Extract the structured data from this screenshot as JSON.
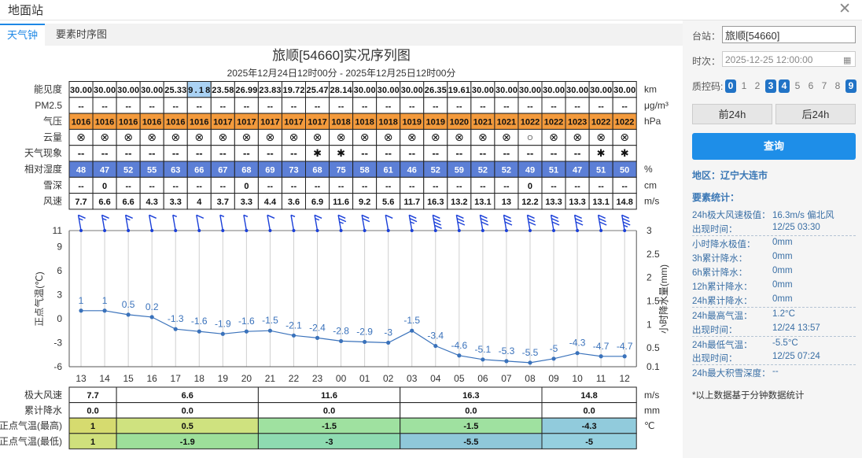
{
  "window": {
    "title": "地面站"
  },
  "tabs": [
    {
      "label": "天气钟"
    },
    {
      "label": "要素时序图"
    }
  ],
  "chart_data": {
    "type": "line",
    "title": "旅顺[54660]实况序列图",
    "subtitle": "2025年12月24日12时00分 - 2025年12月25日12时00分",
    "hours": [
      "13",
      "14",
      "15",
      "16",
      "17",
      "18",
      "19",
      "20",
      "21",
      "22",
      "23",
      "00",
      "01",
      "02",
      "03",
      "04",
      "05",
      "06",
      "07",
      "08",
      "09",
      "10",
      "11",
      "12"
    ],
    "rows": [
      {
        "label": "能见度",
        "unit": "km",
        "kind": "vis",
        "values": [
          "30.00",
          "30.00",
          "30.00",
          "30.00",
          "25.33",
          "9.18",
          "23.58",
          "26.99",
          "23.83",
          "19.72",
          "25.47",
          "28.14",
          "30.00",
          "30.00",
          "30.00",
          "26.35",
          "19.61",
          "30.00",
          "30.00",
          "30.00",
          "30.00",
          "30.00",
          "30.00",
          "30.00"
        ]
      },
      {
        "label": "PM2.5",
        "unit": "μg/m³",
        "kind": "plain",
        "values": [
          "--",
          "--",
          "--",
          "--",
          "--",
          "--",
          "--",
          "--",
          "--",
          "--",
          "--",
          "--",
          "--",
          "--",
          "--",
          "--",
          "--",
          "--",
          "--",
          "--",
          "--",
          "--",
          "--",
          "--"
        ]
      },
      {
        "label": "气压",
        "unit": "hPa",
        "kind": "pres",
        "values": [
          "1016",
          "1016",
          "1016",
          "1016",
          "1016",
          "1016",
          "1017",
          "1017",
          "1017",
          "1017",
          "1017",
          "1018",
          "1018",
          "1018",
          "1019",
          "1019",
          "1020",
          "1021",
          "1021",
          "1022",
          "1022",
          "1023",
          "1022",
          "1022"
        ]
      },
      {
        "label": "云量",
        "unit": "",
        "kind": "cloud",
        "values": [
          "⊗",
          "⊗",
          "⊗",
          "⊗",
          "⊗",
          "⊗",
          "⊗",
          "⊗",
          "⊗",
          "⊗",
          "⊗",
          "⊗",
          "⊗",
          "⊗",
          "⊗",
          "⊗",
          "⊗",
          "⊗",
          "⊗",
          "○",
          "⊗",
          "⊗",
          "⊗",
          "⊗"
        ]
      },
      {
        "label": "天气现象",
        "unit": "",
        "kind": "wx",
        "values": [
          "--",
          "--",
          "--",
          "--",
          "--",
          "--",
          "--",
          "--",
          "--",
          "--",
          "✱",
          "✱",
          "--",
          "--",
          "--",
          "--",
          "--",
          "--",
          "--",
          "--",
          "--",
          "--",
          "✱",
          "✱"
        ]
      },
      {
        "label": "相对湿度",
        "unit": "%",
        "kind": "rh",
        "values": [
          "48",
          "47",
          "52",
          "55",
          "63",
          "66",
          "67",
          "68",
          "69",
          "73",
          "68",
          "75",
          "58",
          "61",
          "46",
          "52",
          "59",
          "52",
          "52",
          "49",
          "51",
          "47",
          "51",
          "50"
        ]
      },
      {
        "label": "雪深",
        "unit": "cm",
        "kind": "plain",
        "values": [
          "--",
          "0",
          "--",
          "--",
          "--",
          "--",
          "--",
          "0",
          "--",
          "--",
          "--",
          "--",
          "--",
          "--",
          "--",
          "--",
          "--",
          "--",
          "--",
          "0",
          "--",
          "--",
          "--",
          "--"
        ]
      },
      {
        "label": "风速",
        "unit": "m/s",
        "kind": "plain",
        "values": [
          "7.7",
          "6.6",
          "6.6",
          "4.3",
          "3.3",
          "4",
          "3.7",
          "3.3",
          "4.4",
          "3.6",
          "6.9",
          "11.6",
          "9.2",
          "5.6",
          "11.7",
          "16.3",
          "13.2",
          "13.1",
          "13",
          "12.2",
          "13.3",
          "13.3",
          "13.1",
          "14.8"
        ]
      }
    ],
    "temperature": [
      1,
      1,
      0.5,
      0.2,
      -1.3,
      -1.6,
      -1.9,
      -1.6,
      -1.5,
      -2.1,
      -2.4,
      -2.8,
      -2.9,
      -3,
      -1.5,
      -3.4,
      -4.6,
      -5.1,
      -5.3,
      -5.5,
      -5,
      -4.3,
      -4.7,
      -4.7
    ],
    "y_left": {
      "label": "正点气温(℃)",
      "ticks": [
        "11",
        "9",
        "6",
        "3",
        "0",
        "-3",
        "-6"
      ],
      "tick_values": [
        11,
        9,
        6,
        3,
        0,
        -3,
        -6
      ],
      "range": [
        -6,
        11
      ]
    },
    "y_right": {
      "label": "小时降水量(mm)",
      "ticks": [
        "3",
        "2.5",
        "2",
        "1.5",
        "1",
        "0.5",
        "0.1"
      ],
      "tick_values": [
        3,
        2.5,
        2,
        1.5,
        1,
        0.5,
        0.1
      ],
      "range": [
        0.1,
        3
      ]
    },
    "summary": {
      "labels": [
        "极大风速",
        "累计降水",
        "正点气温(最高)",
        "正点气温(最低)"
      ],
      "units": [
        "m/s",
        "mm",
        "℃",
        ""
      ],
      "groups": [
        {
          "span": 2,
          "wind": "7.7",
          "rain": "0.0",
          "tmax": "1",
          "tmin": "1",
          "cmax": "#d6db6f",
          "cmin": "#cfe07c"
        },
        {
          "span": 6,
          "wind": "6.6",
          "rain": "0.0",
          "tmax": "0.5",
          "tmin": "-1.9",
          "cmax": "#cfe27f",
          "cmin": "#9ddf9a"
        },
        {
          "span": 6,
          "wind": "11.6",
          "rain": "0.0",
          "tmax": "-1.5",
          "tmin": "-3",
          "cmax": "#9fe1a0",
          "cmin": "#8edbb1"
        },
        {
          "span": 6,
          "wind": "16.3",
          "rain": "0.0",
          "tmax": "-1.5",
          "tmin": "-5.5",
          "cmax": "#9fe1a0",
          "cmin": "#8fc8d9"
        },
        {
          "span": 4,
          "wind": "14.8",
          "rain": "0.0",
          "tmax": "-4.3",
          "tmin": "-5",
          "cmax": "#91cbdc",
          "cmin": "#95d0df"
        }
      ]
    },
    "colors": {
      "line": "#3a72bb",
      "barb": "#1a3fd8",
      "vis_low": "#aad2f4",
      "pres_fill": "#f39a3c",
      "rh_fill": "#5c7fd6",
      "grid": "#cfcfcf"
    }
  },
  "sidebar": {
    "station_label": "台站：",
    "station_value": "旅顺[54660]",
    "time_label": "时次：",
    "time_value": "2025-12-25 12:00:00",
    "qc_label": "质控码:",
    "qc_codes": [
      {
        "code": "0",
        "active": true
      },
      {
        "code": "1",
        "active": false
      },
      {
        "code": "2",
        "active": false
      },
      {
        "code": "3",
        "active": true
      },
      {
        "code": "4",
        "active": true
      },
      {
        "code": "5",
        "active": false
      },
      {
        "code": "6",
        "active": false
      },
      {
        "code": "7",
        "active": false
      },
      {
        "code": "8",
        "active": false
      },
      {
        "code": "9",
        "active": true
      }
    ],
    "prev_button": "前24h",
    "next_button": "后24h",
    "query_button": "查询",
    "region": "地区：辽宁大连市",
    "stats_title": "要素统计：",
    "stats": [
      {
        "key": "24h极大风速极值：",
        "value": "16.3m/s 偏北风",
        "divider": false
      },
      {
        "key": "出现时间：",
        "value": "12/25 03:30",
        "divider": false
      },
      {
        "key": "小时降水极值：",
        "value": "0mm",
        "divider": true
      },
      {
        "key": "3h累计降水：",
        "value": "0mm",
        "divider": false
      },
      {
        "key": "6h累计降水：",
        "value": "0mm",
        "divider": false
      },
      {
        "key": "12h累计降水：",
        "value": "0mm",
        "divider": false
      },
      {
        "key": "24h累计降水：",
        "value": "0mm",
        "divider": false
      },
      {
        "key": "24h最高气温：",
        "value": "1.2°C",
        "divider": true
      },
      {
        "key": "出现时间：",
        "value": "12/24 13:57",
        "divider": false
      },
      {
        "key": "24h最低气温：",
        "value": "-5.5°C",
        "divider": true
      },
      {
        "key": "出现时间：",
        "value": "12/25 07:24",
        "divider": false
      },
      {
        "key": "24h最大积雪深度：",
        "value": "--",
        "divider": true
      }
    ],
    "note": "*以上数据基于分钟数据统计"
  }
}
